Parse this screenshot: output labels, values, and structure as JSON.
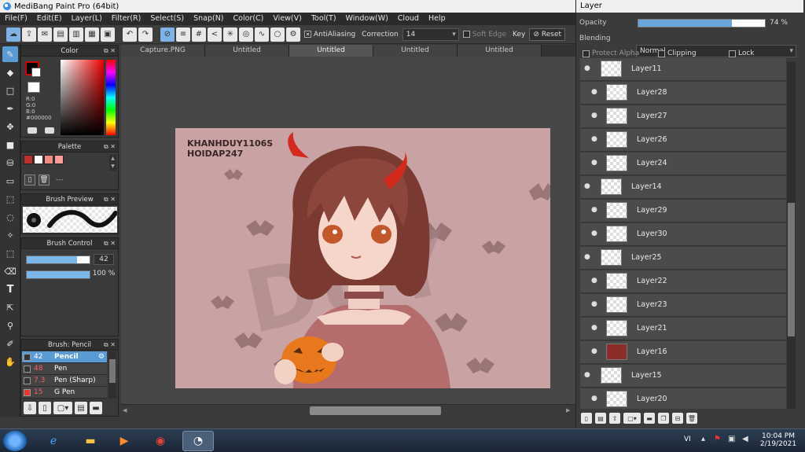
{
  "window": {
    "title": "MediBang Paint Pro (64bit)"
  },
  "menu": [
    "File(F)",
    "Edit(E)",
    "Layer(L)",
    "Filter(R)",
    "Select(S)",
    "Snap(N)",
    "Color(C)",
    "View(V)",
    "Tool(T)",
    "Window(W)",
    "Cloud",
    "Help"
  ],
  "toolbar": {
    "antialiasing_label": "AntiAliasing",
    "correction_label": "Correction",
    "correction_value": "14",
    "soft_edge_label": "Soft Edge",
    "key_label": "Key",
    "reset_label": "Reset"
  },
  "color_panel": {
    "title": "Color",
    "r": "R:0",
    "g": "G:0",
    "b": "B:0",
    "hex": "#000000",
    "fg_color": "#000000",
    "accent": "#cc0000"
  },
  "palette_panel": {
    "title": "Palette",
    "swatches": [
      "#c0312e",
      "#ffffff",
      "#f28b82",
      "#ff9b9b"
    ],
    "dash": "---"
  },
  "brush_preview": {
    "title": "Brush Preview"
  },
  "brush_control": {
    "title": "Brush Control",
    "size_value": "42",
    "opacity_value": "100 %",
    "size_fraction": 0.8,
    "opacity_fraction": 1.0
  },
  "brush_list": {
    "title": "Brush: Pencil",
    "items": [
      {
        "size": "42",
        "name": "Pencil",
        "color": "#cc2222",
        "selected": true
      },
      {
        "size": "48",
        "name": "Pen",
        "color": "#cc2222",
        "selected": false
      },
      {
        "size": "7.3",
        "name": "Pen (Sharp)",
        "color": "#cc2222",
        "selected": false
      },
      {
        "size": "15",
        "name": "G Pen",
        "color": "#cc2222",
        "selected": false
      }
    ]
  },
  "tabs": [
    {
      "label": "Capture.PNG",
      "active": false
    },
    {
      "label": "Untitled",
      "active": false
    },
    {
      "label": "Untitled",
      "active": true
    },
    {
      "label": "Untitled",
      "active": false
    },
    {
      "label": "Untitled",
      "active": false
    }
  ],
  "artwork": {
    "watermark_line1": "KHANHDUY1106S",
    "watermark_line2": "HOIDAP247"
  },
  "layer_panel": {
    "title": "Layer",
    "opacity_label": "Opacity",
    "opacity_value": "74 %",
    "opacity_fraction": 0.74,
    "blending_label": "Blending",
    "blending_value": "Normal",
    "protect_alpha_label": "Protect Alpha",
    "clipping_label": "Clipping",
    "lock_label": "Lock",
    "layers": [
      {
        "name": "Layer11",
        "indent": 0
      },
      {
        "name": "Layer28",
        "indent": 1
      },
      {
        "name": "Layer27",
        "indent": 1
      },
      {
        "name": "Layer26",
        "indent": 1
      },
      {
        "name": "Layer24",
        "indent": 1
      },
      {
        "name": "Layer14",
        "indent": 0
      },
      {
        "name": "Layer29",
        "indent": 1
      },
      {
        "name": "Layer30",
        "indent": 1
      },
      {
        "name": "Layer25",
        "indent": 0
      },
      {
        "name": "Layer22",
        "indent": 1
      },
      {
        "name": "Layer23",
        "indent": 1
      },
      {
        "name": "Layer21",
        "indent": 1
      },
      {
        "name": "Layer16",
        "indent": 1
      },
      {
        "name": "Layer15",
        "indent": 0
      },
      {
        "name": "Layer20",
        "indent": 1
      }
    ]
  },
  "taskbar": {
    "lang": "VI",
    "time": "10:04 PM",
    "date": "2/19/2021"
  }
}
